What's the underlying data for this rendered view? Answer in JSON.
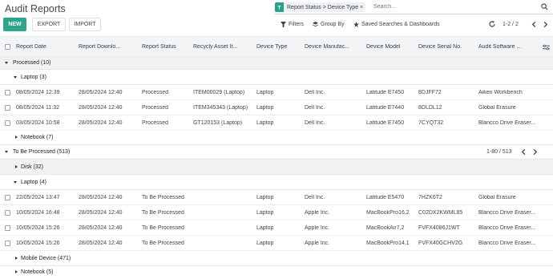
{
  "page": {
    "title": "Audit Reports"
  },
  "buttons": {
    "new": "NEW",
    "export": "EXPORT",
    "import": "IMPORT"
  },
  "search": {
    "facet": "Report Status > Device Type",
    "facet_close": "×",
    "placeholder": "Search..."
  },
  "toolbar": {
    "filters": "Filters",
    "group_by": "Group By",
    "saved": "Saved Searches & Dashboards",
    "pager": "1-2 / 2"
  },
  "columns": [
    "Report Date",
    "Report Downlo...",
    "Report Status",
    "Recycly Asset It...",
    "Device Type",
    "Device Manufac...",
    "Device Model",
    "Device Serial No.",
    "Audit Software ..."
  ],
  "groups": {
    "processed": {
      "label": "Processed (10)"
    },
    "laptop_processed": {
      "label": "Laptop (3)"
    },
    "notebook_processed": {
      "label": "Notebook (7)"
    },
    "to_be_processed": {
      "label": "To Be Processed (513)",
      "pager": "1-80 / 513"
    },
    "disk": {
      "label": "Disk (32)"
    },
    "laptop_tbp": {
      "label": "Laptop (4)"
    },
    "mobile": {
      "label": "Mobile Device (471)"
    },
    "notebook_tbp": {
      "label": "Notebook (5)"
    }
  },
  "rows_processed": [
    [
      "08/05/2024 12:39",
      "28/05/2024 12:40",
      "Processed",
      "ITEM00029 (Laptop)",
      "Laptop",
      "Dell Inc.",
      "Latitude E7450",
      "8DJFF72",
      "Aiken Workbench"
    ],
    [
      "08/05/2024 11:32",
      "28/05/2024 12:40",
      "Processed",
      "ITEM345343 (Laptop)",
      "Laptop",
      "Dell Inc.",
      "Latitude E7440",
      "8DLDL12",
      "Global Erasure"
    ],
    [
      "03/05/2024 10:58",
      "28/05/2024 12:40",
      "Processed",
      "GT120153 (Laptop)",
      "Laptop",
      "Dell Inc.",
      "Latitude E7450",
      "7CYQT32",
      "Blancco Drive Eraser..."
    ]
  ],
  "rows_tbp": [
    [
      "22/05/2024 13:47",
      "28/05/2024 12:40",
      "To Be Processed",
      "",
      "Laptop",
      "Dell Inc.",
      "Latitude E5470",
      "7HZK6T2",
      "Global Erasure"
    ],
    [
      "10/05/2024 16:48",
      "28/05/2024 12:40",
      "To Be Processed",
      "",
      "Laptop",
      "Apple Inc.",
      "MacBookPro16,2",
      "C02DX2KWML85",
      "Blancco Drive Eraser..."
    ],
    [
      "10/05/2024 15:26",
      "28/05/2024 12:40",
      "To Be Processed",
      "",
      "Laptop",
      "Apple Inc.",
      "MacBookAir7,2",
      "FVFX4086J1WT",
      "Blancco Drive Eraser..."
    ],
    [
      "10/05/2024 15:26",
      "28/05/2024 12:40",
      "To Be Processed",
      "",
      "Laptop",
      "Apple Inc.",
      "MacBookPro14,1",
      "FVFX40GCHV2G",
      "Blancco Drive Eraser..."
    ]
  ],
  "colors": {
    "primary": "#2da58c",
    "header_bg": "#f3f4f6",
    "group_bg": "#f1f2f4"
  },
  "icons": [
    "filter-icon",
    "group-by-icon",
    "star-icon",
    "refresh-icon",
    "search-icon",
    "chevron-left-icon",
    "chevron-right-icon",
    "column-options-icon"
  ]
}
